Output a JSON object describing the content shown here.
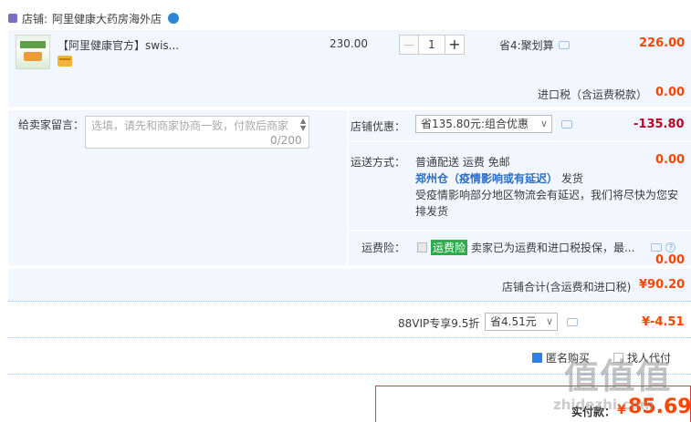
{
  "shop": {
    "label": "店铺:",
    "name": "阿里健康大药房海外店"
  },
  "item": {
    "title": "【阿里健康官方】swis...",
    "price": "230.00",
    "quantity": "1",
    "minus": "—",
    "plus": "+",
    "discount": "省4:聚划算",
    "total": "226.00"
  },
  "import_tax": {
    "label": "进口税（含运费税款）",
    "value": "0.00"
  },
  "message": {
    "label": "给卖家留言：",
    "placeholder": "选填，请先和商家协商一致，付款后商家",
    "count": "0/200"
  },
  "shop_discount": {
    "label": "店铺优惠：",
    "selected": "省135.80元:组合优惠",
    "value": "-135.80"
  },
  "shipping": {
    "label": "运送方式：",
    "method": "普通配送 运费 免邮",
    "warehouse": "郑州仓（疫情影响或有延迟）",
    "warehouse_suffix": "发货",
    "note_line1": "受疫情影响部分地区物流会有延迟，我们将尽快为您安",
    "note_line2": "排发货",
    "value": "0.00"
  },
  "insurance": {
    "label": "运费险：",
    "tag": "运费险",
    "desc": "卖家已为运费和进口税投保，最...",
    "value": "0.00"
  },
  "subtotal": {
    "label": "店铺合计(含运费和进口税)",
    "value": "¥90.20"
  },
  "vip": {
    "label": "88VIP专享9.5折",
    "selected": "省4.51元",
    "value": "¥-4.51"
  },
  "options": {
    "anonymous": "匿名购买",
    "other": "找人代付"
  },
  "payment": {
    "label": "实付款：",
    "currency": "¥",
    "value": "85.69"
  },
  "watermark": {
    "text": "值 值 值",
    "sub": "zhidezhi.com"
  },
  "colors": {
    "panel_bg": "#f2f7ff",
    "price_red": "#ff4400",
    "discount_red": "#c40022",
    "accent_blue": "#2c80e8"
  }
}
